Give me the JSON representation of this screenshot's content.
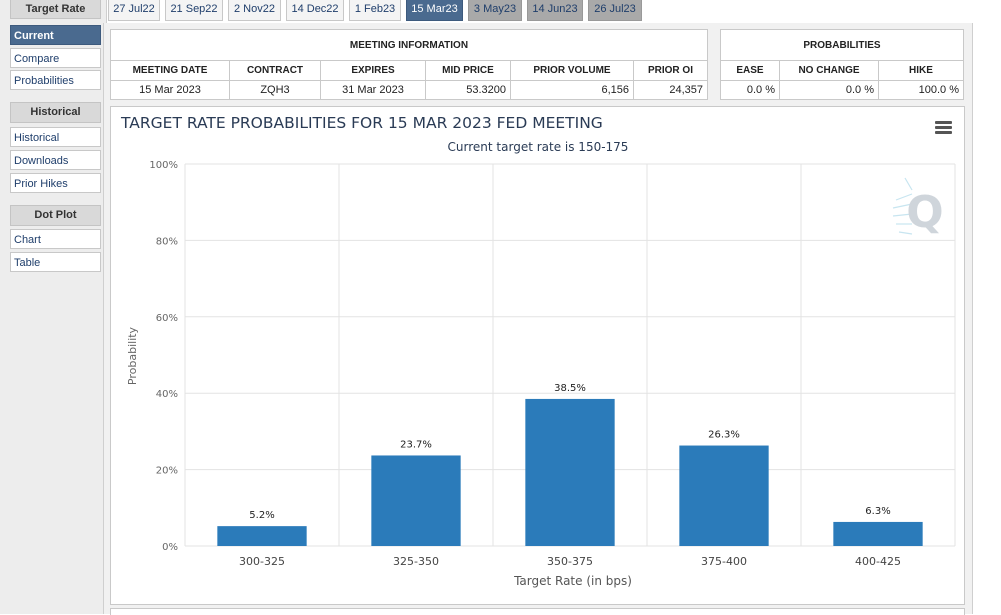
{
  "sidebar": {
    "target_rate": {
      "label": "Target Rate",
      "items": [
        "Current",
        "Compare",
        "Probabilities"
      ]
    },
    "historical": {
      "label": "Historical",
      "items": [
        "Historical",
        "Downloads",
        "Prior Hikes"
      ]
    },
    "dot_plot": {
      "label": "Dot Plot",
      "items": [
        "Chart",
        "Table"
      ]
    }
  },
  "tabs": [
    "27 Jul22",
    "21 Sep22",
    "2 Nov22",
    "14 Dec22",
    "1 Feb23",
    "15 Mar23",
    "3 May23",
    "14 Jun23",
    "26 Jul23"
  ],
  "meeting_info": {
    "title": "MEETING INFORMATION",
    "headers": [
      "MEETING DATE",
      "CONTRACT",
      "EXPIRES",
      "MID PRICE",
      "PRIOR VOLUME",
      "PRIOR OI"
    ],
    "values": [
      "15 Mar 2023",
      "ZQH3",
      "31 Mar 2023",
      "53.3200",
      "6,156",
      "24,357"
    ]
  },
  "probabilities": {
    "title": "PROBABILITIES",
    "headers": [
      "EASE",
      "NO CHANGE",
      "HIKE"
    ],
    "values": [
      "0.0 %",
      "0.0 %",
      "100.0 %"
    ]
  },
  "chart_data": {
    "type": "bar",
    "title": "TARGET RATE PROBABILITIES FOR 15 MAR 2023 FED MEETING",
    "subtitle": "Current target rate is 150-175",
    "xlabel": "Target Rate (in bps)",
    "ylabel": "Probability",
    "categories": [
      "300-325",
      "325-350",
      "350-375",
      "375-400",
      "400-425"
    ],
    "values": [
      5.2,
      23.7,
      38.5,
      26.3,
      6.3
    ],
    "value_labels": [
      "5.2%",
      "23.7%",
      "38.5%",
      "26.3%",
      "6.3%"
    ],
    "ylim": [
      0,
      100
    ],
    "yticks": [
      0,
      20,
      40,
      60,
      80,
      100
    ],
    "ytick_labels": [
      "0%",
      "20%",
      "40%",
      "60%",
      "80%",
      "100%"
    ],
    "grid": true,
    "bar_color": "#2b7bba"
  }
}
